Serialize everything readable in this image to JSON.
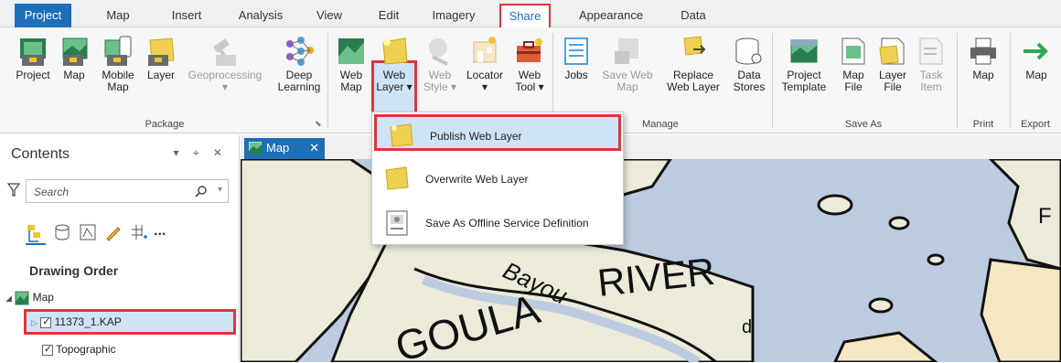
{
  "ribbon_tabs": [
    "Project",
    "Map",
    "Insert",
    "Analysis",
    "View",
    "Edit",
    "Imagery",
    "Share",
    "Appearance",
    "Data"
  ],
  "package_group": {
    "label": "Package",
    "buttons": [
      {
        "l1": "Project",
        "l2": ""
      },
      {
        "l1": "Map",
        "l2": ""
      },
      {
        "l1": "Mobile",
        "l2": "Map"
      },
      {
        "l1": "Layer",
        "l2": ""
      },
      {
        "l1": "Geoprocessing",
        "l2": "▾"
      },
      {
        "l1": "Deep",
        "l2": "Learning"
      }
    ]
  },
  "share_group": {
    "buttons": [
      {
        "l1": "Web",
        "l2": "Map"
      },
      {
        "l1": "Web",
        "l2": "Layer ▾"
      },
      {
        "l1": "Web",
        "l2": "Style ▾"
      },
      {
        "l1": "Locator",
        "l2": "▾"
      },
      {
        "l1": "Web",
        "l2": "Tool ▾"
      }
    ]
  },
  "manage_group": {
    "label": "Manage",
    "buttons": [
      {
        "l1": "Jobs",
        "l2": ""
      },
      {
        "l1": "Save Web",
        "l2": "Map"
      },
      {
        "l1": "Replace",
        "l2": "Web Layer"
      },
      {
        "l1": "Data",
        "l2": "Stores"
      }
    ]
  },
  "saveas_group": {
    "label": "Save As",
    "buttons": [
      {
        "l1": "Project",
        "l2": "Template"
      },
      {
        "l1": "Map",
        "l2": "File"
      },
      {
        "l1": "Layer",
        "l2": "File"
      },
      {
        "l1": "Task",
        "l2": "Item"
      }
    ]
  },
  "print_group": {
    "label": "Print",
    "button": "Map"
  },
  "export_group": {
    "label": "Export",
    "button": "Map"
  },
  "dropdown": {
    "items": [
      "Publish Web Layer",
      "Overwrite Web Layer",
      "Save As Offline Service Definition"
    ]
  },
  "contents": {
    "title": "Contents",
    "pane_controls": "▾ ⌖ ✕",
    "search_placeholder": "Search",
    "more": "...",
    "drawing_order": "Drawing Order",
    "tree": {
      "map": "Map",
      "layer1": "11373_1.KAP",
      "layer2": "Topographic"
    }
  },
  "map_tab": {
    "label": "Map",
    "close": "✕"
  },
  "map_labels": {
    "bayou": "Bayou",
    "river": "RIVER",
    "goula": "GOULA",
    "edge_f": "F",
    "partial_d": "d"
  },
  "colors": {
    "accent": "#1d6fb8",
    "highlight_border": "#e0343b",
    "highlight_fill": "#cde4f7",
    "water": "#bccbe0",
    "land": "#ecebd9",
    "land_tan": "#f4e7c2"
  }
}
